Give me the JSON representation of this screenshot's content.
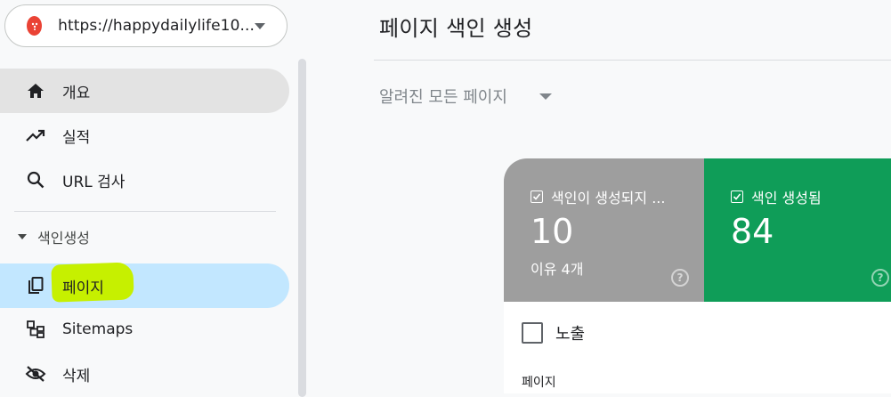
{
  "property": {
    "url": "https://happydailylife10...",
    "icon": "site-favicon"
  },
  "sidebar": {
    "items": [
      {
        "label": "개요",
        "icon": "home-icon"
      },
      {
        "label": "실적",
        "icon": "trending-up-icon"
      },
      {
        "label": "URL 검사",
        "icon": "search-icon"
      }
    ],
    "section": {
      "label": "색인생성"
    },
    "index_items": [
      {
        "label": "페이지",
        "icon": "file-copy-icon"
      },
      {
        "label": "Sitemaps",
        "icon": "sitemap-icon"
      },
      {
        "label": "삭제",
        "icon": "visibility-off-icon"
      }
    ]
  },
  "main": {
    "title": "페이지 색인 생성",
    "filter": "알려진 모든 페이지",
    "cards": [
      {
        "label": "색인이 생성되지 ...",
        "value": "10",
        "sub": "이유 4개",
        "color": "#9e9e9e"
      },
      {
        "label": "색인 생성됨",
        "value": "84",
        "color": "#0f9d58"
      }
    ],
    "exposure_label": "노출",
    "table_label": "페이지"
  },
  "colors": {
    "accent_blue": "#c2e7ff",
    "highlight": "#c6f000"
  }
}
